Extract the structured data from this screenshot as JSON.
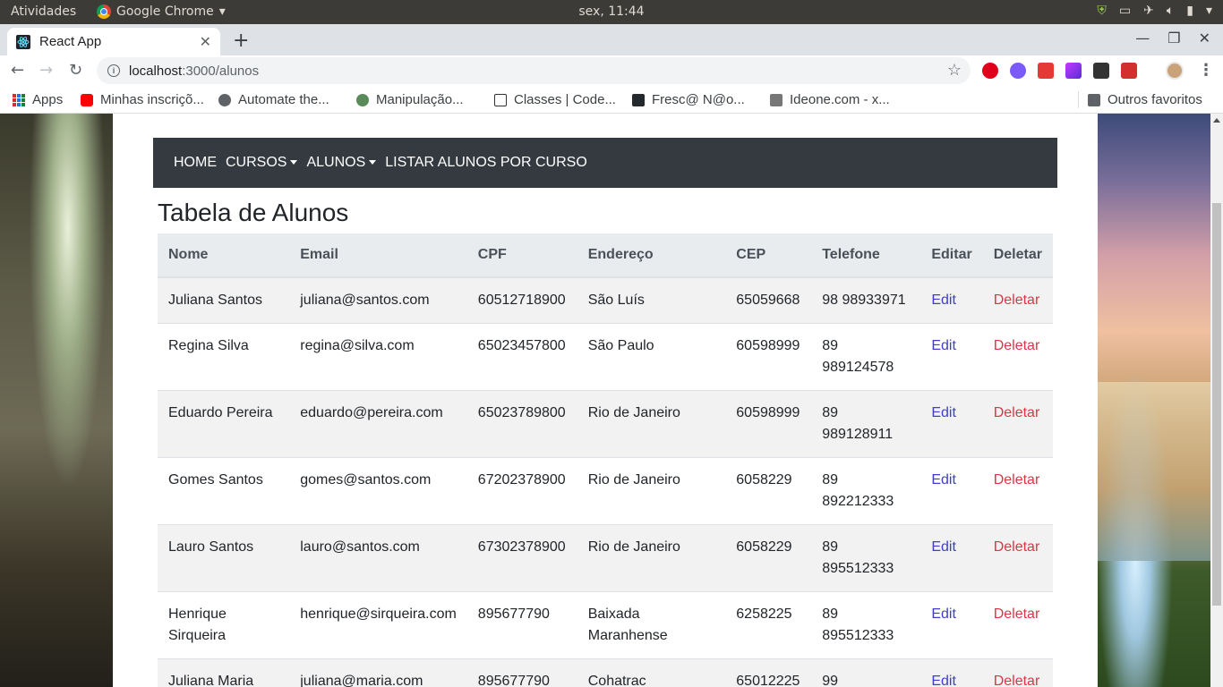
{
  "os_bar": {
    "activities": "Atividades",
    "app_name": "Google Chrome",
    "clock": "sex, 11:44"
  },
  "browser": {
    "tab_title": "React App",
    "url_host": "localhost",
    "url_path": ":3000/alunos",
    "bookmarks": [
      {
        "label": "Apps",
        "icon": "apps-grid-icon"
      },
      {
        "label": "Minhas inscriçõ...",
        "icon": "youtube-icon",
        "color": "#ff0000"
      },
      {
        "label": "Automate the...",
        "icon": "globe-icon",
        "color": "#5f6368"
      },
      {
        "label": "Manipulação...",
        "icon": "site-icon",
        "color": "#5a8a5a"
      },
      {
        "label": "Classes | Code...",
        "icon": "code-icon",
        "color": "#333333"
      },
      {
        "label": "Fresc@ N@o...",
        "icon": "github-icon",
        "color": "#24292e"
      },
      {
        "label": "Ideone.com - x...",
        "icon": "ideone-icon",
        "color": "#777777"
      }
    ],
    "other_bookmarks": "Outros favoritos"
  },
  "app": {
    "nav": {
      "home": "HOME",
      "cursos": "CURSOS",
      "alunos": "ALUNOS",
      "listar": "LISTAR ALUNOS POR CURSO"
    },
    "title": "Tabela de Alunos",
    "table": {
      "headers": [
        "Nome",
        "Email",
        "CPF",
        "Endereço",
        "CEP",
        "Telefone",
        "Editar",
        "Deletar"
      ],
      "rows": [
        {
          "nome": "Juliana Santos",
          "email": "juliana@santos.com",
          "cpf": "60512718900",
          "endereco": "São Luís",
          "cep": "65059668",
          "telefone": "98 98933971",
          "edit": "Edit",
          "deletar": "Deletar"
        },
        {
          "nome": "Regina Silva",
          "email": "regina@silva.com",
          "cpf": "65023457800",
          "endereco": "São Paulo",
          "cep": "60598999",
          "telefone": "89 989124578",
          "edit": "Edit",
          "deletar": "Deletar"
        },
        {
          "nome": "Eduardo Pereira",
          "email": "eduardo@pereira.com",
          "cpf": "65023789800",
          "endereco": "Rio de Janeiro",
          "cep": "60598999",
          "telefone": "89 989128911",
          "edit": "Edit",
          "deletar": "Deletar"
        },
        {
          "nome": "Gomes Santos",
          "email": "gomes@santos.com",
          "cpf": "67202378900",
          "endereco": "Rio de Janeiro",
          "cep": "6058229",
          "telefone": "89 892212333",
          "edit": "Edit",
          "deletar": "Deletar"
        },
        {
          "nome": "Lauro Santos",
          "email": "lauro@santos.com",
          "cpf": "67302378900",
          "endereco": "Rio de Janeiro",
          "cep": "6058229",
          "telefone": "89 895512333",
          "edit": "Edit",
          "deletar": "Deletar"
        },
        {
          "nome": "Henrique Sirqueira",
          "email": "henrique@sirqueira.com",
          "cpf": "895677790",
          "endereco": "Baixada Maranhense",
          "cep": "6258225",
          "telefone": "89 895512333",
          "edit": "Edit",
          "deletar": "Deletar"
        },
        {
          "nome": "Juliana Maria",
          "email": "juliana@maria.com",
          "cpf": "895677790",
          "endereco": "Cohatrac",
          "cep": "65012225",
          "telefone": "99",
          "edit": "Edit",
          "deletar": "Deletar"
        }
      ]
    }
  }
}
